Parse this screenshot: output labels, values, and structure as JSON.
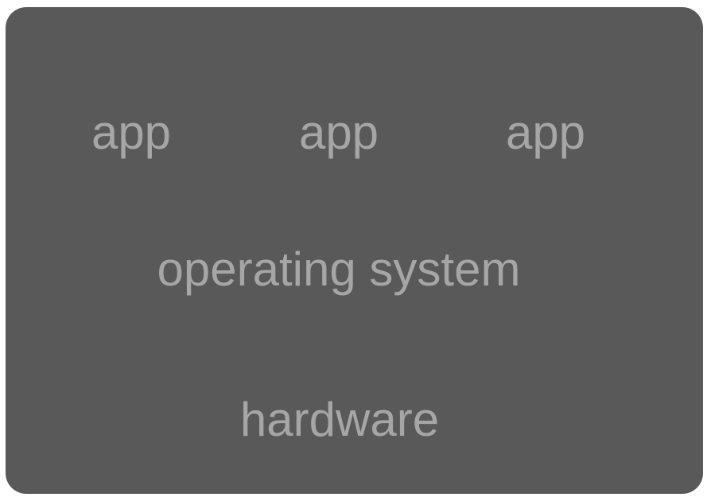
{
  "diagram": {
    "apps": [
      {
        "label": "app"
      },
      {
        "label": "app"
      },
      {
        "label": "app"
      }
    ],
    "os_label": "operating system",
    "hardware_label": "hardware"
  },
  "colors": {
    "page_background": "#ffffff",
    "panel_background": "#595959",
    "text": "#a6a6a6"
  }
}
